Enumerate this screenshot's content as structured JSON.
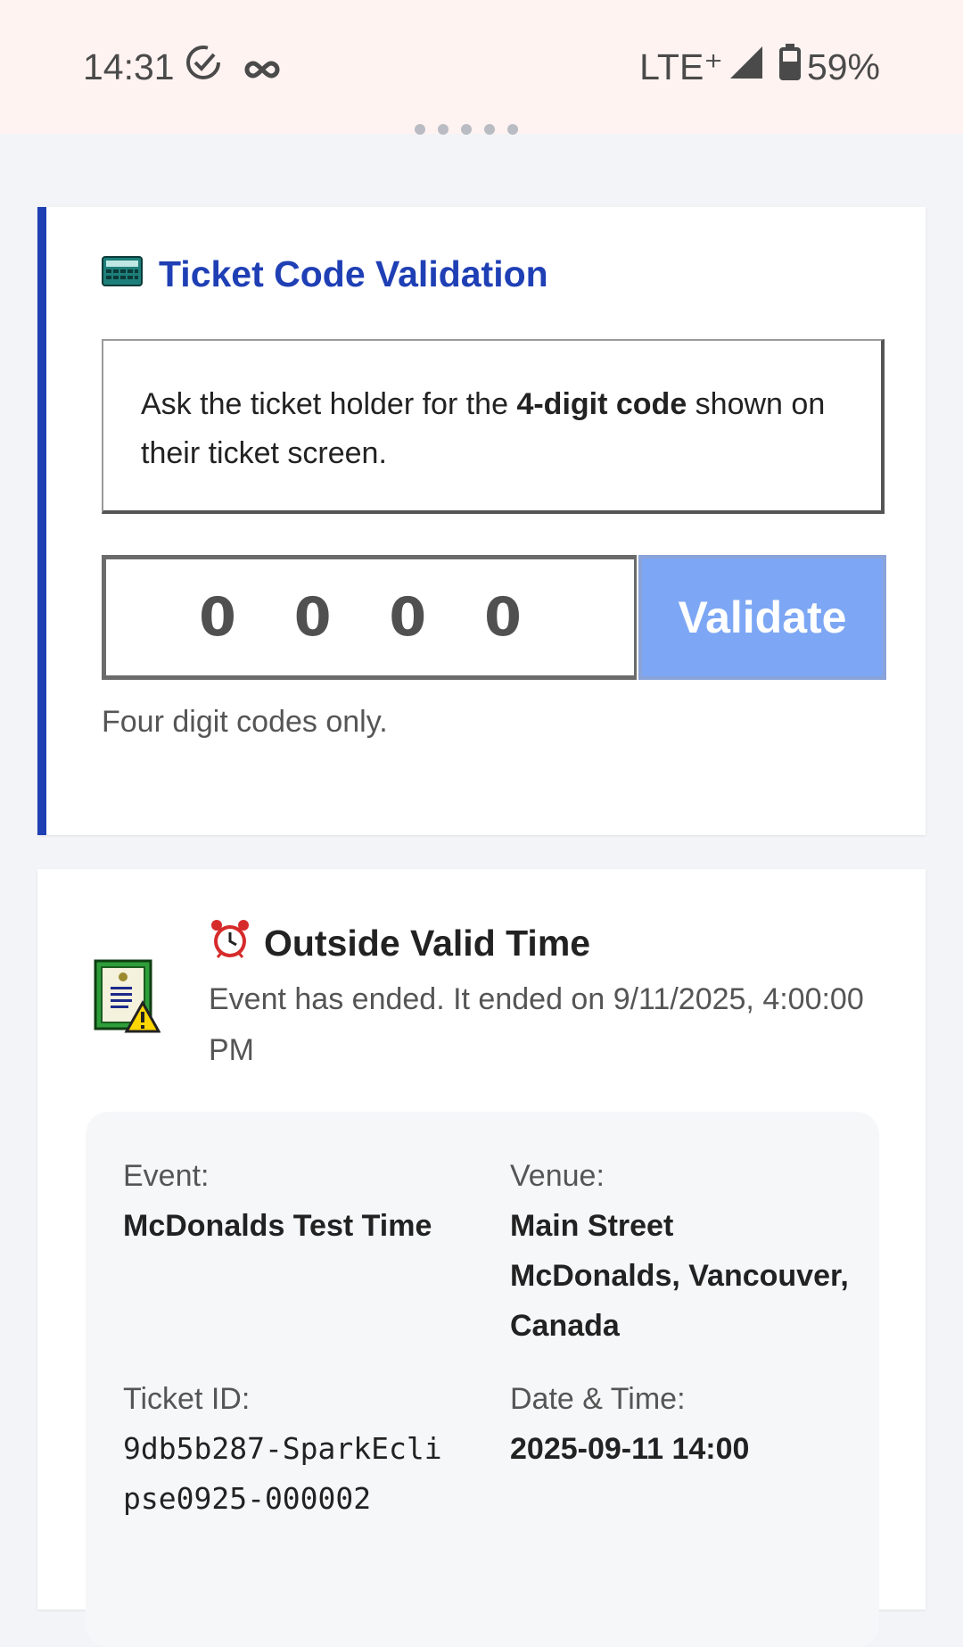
{
  "status_bar": {
    "time": "14:31",
    "network": "LTE⁺",
    "battery": "59%"
  },
  "validation": {
    "title": "Ticket Code Validation",
    "title_icon": "calculator-icon",
    "instruction_pre": "Ask the ticket holder for the ",
    "instruction_bold": "4-digit code",
    "instruction_post": " shown on their ticket screen.",
    "code_placeholder": "0000",
    "code_display": "0 0 0 0",
    "validate_label": "Validate",
    "hint": "Four digit codes only."
  },
  "result": {
    "status_icon": "alarm-clock-icon",
    "title": "Outside Valid Time",
    "message": "Event has ended. It ended on 9/11/2025, 4:00:00 PM",
    "details": {
      "event_label": "Event:",
      "event_value": "McDonalds Test Time",
      "venue_label": "Venue:",
      "venue_value": "Main Street McDonalds, Vancouver, Canada",
      "ticket_label": "Ticket ID:",
      "ticket_value": "9db5b287-SparkEclipse0925-000002",
      "datetime_label": "Date & Time:",
      "datetime_value": "2025-09-11 14:00"
    }
  },
  "colors": {
    "accent": "#1f3fb5",
    "button": "#7da7f4",
    "status_bar_bg": "#fff3f1",
    "page_bg": "#f2f4f7"
  }
}
